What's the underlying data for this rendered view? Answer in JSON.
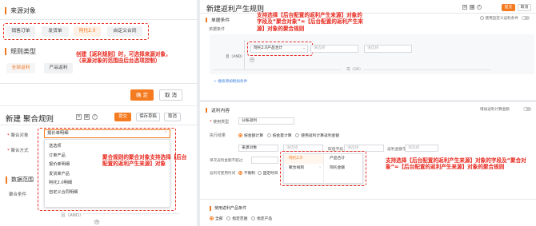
{
  "p1": {
    "section_source": "来源对象",
    "tabs": [
      "销售订单",
      "发货单",
      "阿托2.0",
      "自定义合同"
    ],
    "active_tab_index": 2,
    "section_rule": "规则类型",
    "rule_chips": [
      "全部返利",
      "产品返利"
    ],
    "note": "创建【返利规则】时，可选择来源对象，（来源对象的范围由后台选项控制）",
    "confirm": "确 定",
    "cancel": "取 消"
  },
  "p2": {
    "title": "新建 聚合规则",
    "toolbar_icons": [
      "list-view-icon",
      "grid-view-icon",
      "help-icon"
    ],
    "submit": "提交",
    "save_draft": "保存草稿",
    "cancel": "取消",
    "field_agg_object": "聚合对象",
    "field_agg_method": "聚合方式",
    "section_data_range": "数据范围",
    "field_agg_condition": "聚合条件",
    "selected_value": "报价单明细",
    "dropdown_items": [
      "选选项",
      "订单产品",
      "报价单明细",
      "发货单产品",
      "阿托2.0明细",
      "自定义合同明细"
    ],
    "condition_text": "且（AND）",
    "note": "聚合规则的聚合对象支持选择【后台配置的返利产生来源】对象"
  },
  "p3": {
    "title": "新建返利产生规则",
    "cancel": "取消",
    "submit": "提交",
    "toggle_label": "使用自定义返利条件",
    "section_condition": "单据条件",
    "sub_single": "单据条件",
    "and_label": "且（AND）",
    "field_select": "阿托2.0产品合计",
    "op_placeholder": "请选择",
    "value_placeholder": "请选择",
    "or_label": "或（OR）",
    "add_group": "+ 继续添加附加条件",
    "note": "支持选择【后台配置的返利产生来源】对象的字段及“聚合对象”=【后台配置的返利产生来源】对象的聚合规则"
  },
  "p4": {
    "section_content": "返利内容",
    "toggle_label": "增加返利计算金额",
    "field_type": "使用类型",
    "type_value": "分账返利",
    "field_calc_method": "执行结果",
    "radio_options": [
      "按金额计算",
      "按金量计算",
      "使用返利计算返利金额"
    ],
    "radio_active_index": 0,
    "field_source": "来源对象",
    "source_placeholder": "请选择",
    "field_field": "取值字段",
    "field_field_placeholder": "请选择",
    "field_formula": "返利金额字段",
    "formula_placeholder": "请选择",
    "field_single_limit": "单次返利金额不超过",
    "field_limit_rule": "返利需要满足比较日期",
    "field_calc_time": "返利可使用时间",
    "calc_time_options": [
      "不限制",
      "固定时间"
    ],
    "calc_time_active_index": 0,
    "dd_selected": "阿托2.0",
    "dd_left_items": [
      "阿托2.0",
      "聚合规则"
    ],
    "dd_right_items": [
      "产品合计",
      "阿托金额"
    ],
    "section_product": "使用返利产品条件",
    "product_options": [
      "全部",
      "指定范围",
      "指定产品"
    ],
    "product_active_index": 0,
    "note": "支持选择【后台配置的返利产生来源】对象的字段及“聚合对象”=【后台配置的返利产生来源】对象的聚合规则"
  }
}
